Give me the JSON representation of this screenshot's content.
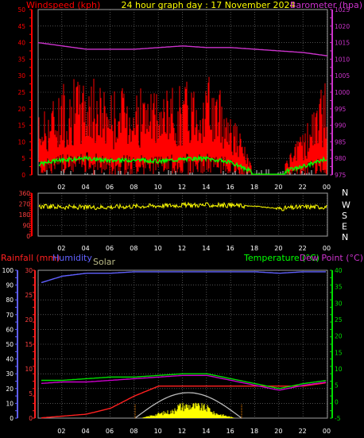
{
  "header": {
    "left": "Windspeed (kph)",
    "center": "24 hour graph day : 17 November 2024",
    "right": "Barometer (hpa)"
  },
  "colors": {
    "wind_max": "#ff0000",
    "wind_avg": "#00ff00",
    "barometer": "#cc33cc",
    "direction": "#ffff00",
    "rain": "#ff2020",
    "humidity": "#6060ff",
    "solar_curve": "#bbbbbb",
    "solar_fill": "#ffff00",
    "temperature": "#00dd00",
    "dewpoint": "#cc00cc",
    "grid": "#808080"
  },
  "bottom_labels": {
    "rainfall": "Rainfall (mm)",
    "humidity": "Humidity",
    "solar": "Solar",
    "temperature": "Temperature (°C)",
    "dewpoint": "Dew Point (°C)"
  },
  "compass": [
    "N",
    "W",
    "S",
    "E",
    "N"
  ],
  "x_ticks": [
    "02",
    "04",
    "06",
    "08",
    "10",
    "12",
    "14",
    "16",
    "18",
    "20",
    "22",
    "00"
  ],
  "chart_data": [
    {
      "type": "line",
      "title": "24 hour graph day : 17 November 2024",
      "ylabel_left": "Windspeed (kph)",
      "ylabel_right": "Barometer (hpa)",
      "x": [
        "00",
        "02",
        "04",
        "06",
        "08",
        "10",
        "12",
        "14",
        "16",
        "18",
        "20",
        "22",
        "00"
      ],
      "ylim_left": [
        0,
        50
      ],
      "yticks_left": [
        0,
        5,
        10,
        15,
        20,
        25,
        30,
        35,
        40,
        45,
        50
      ],
      "ylim_right": [
        975,
        1025
      ],
      "yticks_right": [
        975,
        980,
        985,
        990,
        995,
        1000,
        1005,
        1010,
        1015,
        1020,
        1025
      ],
      "grid": true,
      "series": [
        {
          "name": "Windspeed (kph)",
          "values": [
            12,
            18,
            20,
            17,
            18,
            16,
            19,
            20,
            14,
            0,
            0,
            9,
            20
          ]
        },
        {
          "name": "Barometer (hpa)",
          "values": [
            1015,
            1014,
            1013,
            1013,
            1013,
            1013.5,
            1014,
            1013.5,
            1013.5,
            1013,
            1012.5,
            1012,
            1011
          ]
        }
      ]
    },
    {
      "type": "line",
      "ylabel_right": [
        "N",
        "W",
        "S",
        "E",
        "N"
      ],
      "ylim": [
        0,
        360
      ],
      "yticks": [
        0,
        90,
        180,
        270,
        360
      ],
      "x": [
        "00",
        "02",
        "04",
        "06",
        "08",
        "10",
        "12",
        "14",
        "16",
        "18",
        "20",
        "22",
        "00"
      ],
      "grid": true,
      "series": [
        {
          "name": "Wind direction",
          "values": [
            250,
            245,
            240,
            245,
            250,
            255,
            260,
            260,
            258,
            250,
            230,
            245,
            245
          ]
        }
      ]
    },
    {
      "type": "line",
      "x": [
        "00",
        "02",
        "04",
        "06",
        "08",
        "10",
        "12",
        "14",
        "16",
        "18",
        "20",
        "22",
        "00"
      ],
      "grid": true,
      "axes": {
        "humidity": {
          "label": "Humidity",
          "ylim": [
            0,
            100
          ],
          "yticks": [
            0,
            10,
            20,
            30,
            40,
            50,
            60,
            70,
            80,
            90,
            100
          ]
        },
        "rainfall": {
          "label": "Rainfall (mm)",
          "ylim": [
            0,
            30
          ],
          "yticks": [
            0,
            5,
            10,
            15,
            20,
            25,
            30
          ]
        },
        "temperature": {
          "label": "Temperature (°C)",
          "ylim": [
            -5,
            40
          ],
          "yticks": [
            -5,
            0,
            5,
            10,
            15,
            20,
            25,
            30,
            35,
            40
          ]
        }
      },
      "series": [
        {
          "name": "Humidity",
          "axis": "humidity",
          "values": [
            91,
            96,
            98,
            98,
            99,
            99,
            99,
            99,
            99,
            99,
            98,
            99,
            99
          ]
        },
        {
          "name": "Rainfall (mm)",
          "axis": "rainfall",
          "values": [
            0,
            0.4,
            0.8,
            2.0,
            4.5,
            6.5,
            6.5,
            6.5,
            6.5,
            6.5,
            6.5,
            6.5,
            7.2
          ]
        },
        {
          "name": "Temperature (°C)",
          "axis": "temperature",
          "values": [
            6.5,
            6.5,
            7.0,
            7.5,
            7.5,
            8.0,
            8.5,
            8.5,
            7.0,
            5.5,
            4.0,
            5.5,
            6.5
          ]
        },
        {
          "name": "Dew Point (°C)",
          "axis": "temperature",
          "values": [
            5.5,
            6.0,
            6.0,
            6.5,
            7.0,
            7.5,
            8.0,
            8.0,
            6.5,
            5.0,
            3.5,
            5.0,
            6.0
          ]
        },
        {
          "name": "Solar",
          "axis": "rainfall",
          "values": [
            0,
            0,
            0,
            0,
            0.5,
            1.5,
            3.5,
            3.0,
            1.0,
            0,
            0,
            0,
            0
          ]
        }
      ]
    }
  ]
}
